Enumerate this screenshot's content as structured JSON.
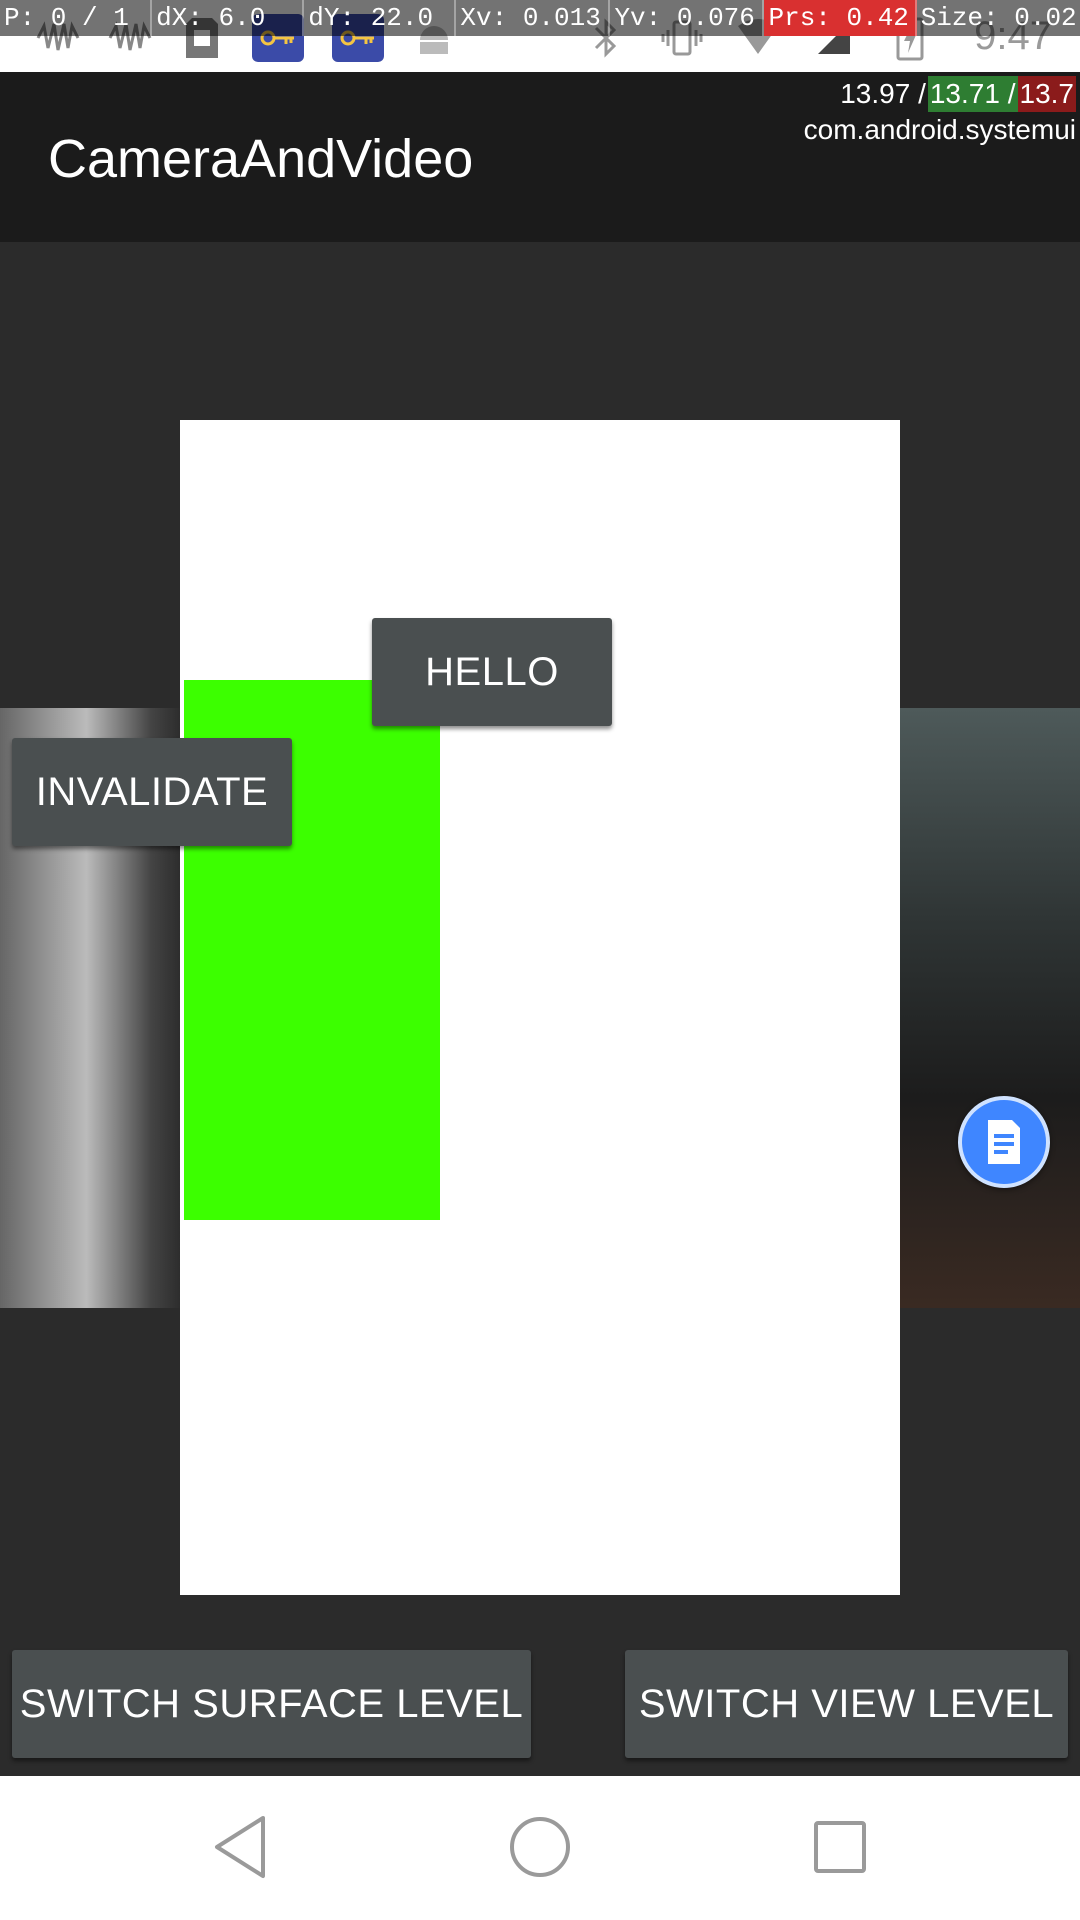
{
  "status_bar": {
    "time": "9:47",
    "icons": [
      "voicemail-icon",
      "voicemail-icon",
      "sd-card-icon",
      "vpn-key-icon",
      "vpn-key-icon",
      "android-icon",
      "bluetooth-icon",
      "vibrate-icon",
      "wifi-icon",
      "no-signal-icon",
      "battery-charging-icon"
    ]
  },
  "pointer_location": {
    "p": "P: 0 / 1",
    "dx": "dX: 6.0",
    "dy": "dY: 22.0",
    "xv": "Xv: 0.013",
    "yv": "Yv: 0.076",
    "prs": "Prs: 0.42",
    "size": "Size: 0.02"
  },
  "cpu_overlay": {
    "load_1": "13.97 / ",
    "load_2": "13.71 / ",
    "load_3": "13.7",
    "process": "com.android.systemui"
  },
  "app_bar": {
    "title": "CameraAndVideo"
  },
  "buttons": {
    "hello": "HELLO",
    "invalidate": "INVALIDATE",
    "switch_surface": "SWITCH SURFACE LEVEL",
    "switch_view": "SWITCH VIEW LEVEL"
  },
  "colors": {
    "app_bar": "#1b1b1b",
    "background": "#2b2b2b",
    "button": "#4a4f50",
    "green_view": "#3cff00",
    "fab": "#3f86ff"
  },
  "nav_bar": {
    "icons": [
      "back-icon",
      "home-icon",
      "recents-icon"
    ]
  }
}
